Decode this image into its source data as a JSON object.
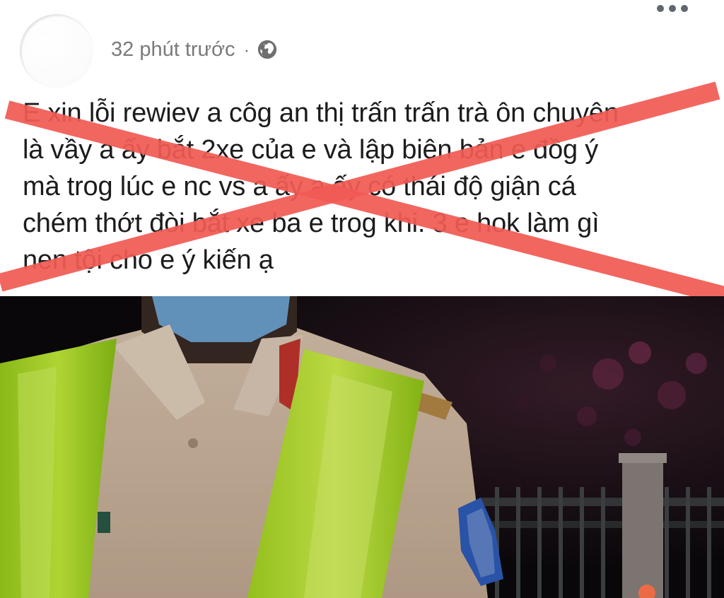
{
  "post": {
    "timestamp": "32 phút trước",
    "separator": "·",
    "privacy_icon": "globe-icon",
    "menu_icon": "more-options-icon",
    "text_lines": [
      "E xin lỗi rewiev a côg an thị trấn trấn trà ôn chuyên",
      "là vầy a ấy bắt  2xe của e và lập biên bản e đồg ý",
      "mà trog lúc e nc vs a ấy a ấy có thái độ giận cá",
      "chém thớt đòi bắt xe ba e trog khi. 3 e hok làm gì",
      "nen tội cho e ý kiến ạ"
    ],
    "overlay_mark": "red-cross-mark",
    "overlay_color": "#f25b55",
    "photo": "night photo of traffic police officer in reflective vest and face mask"
  }
}
